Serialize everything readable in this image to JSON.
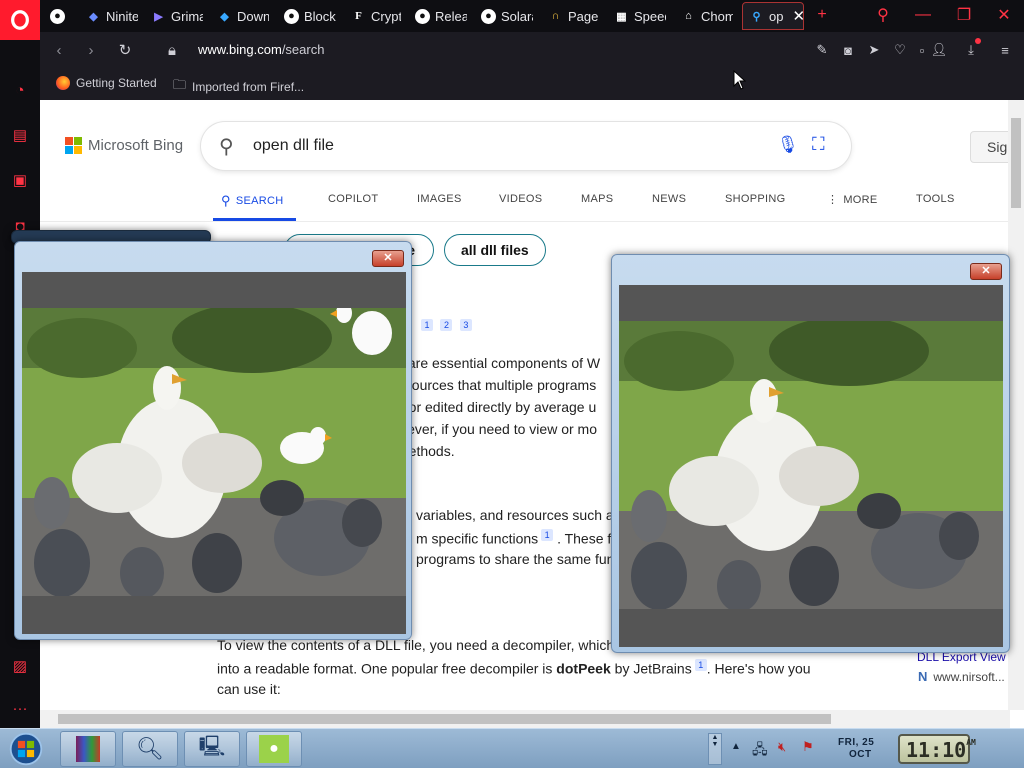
{
  "tabs": [
    {
      "label": "",
      "icon": "opera-logo-icon"
    },
    {
      "label": "",
      "icon": "globe-icon"
    },
    {
      "label": "Ninite",
      "icon": "ninite-icon"
    },
    {
      "label": "Grima",
      "icon": "grimace-icon"
    },
    {
      "label": "Down",
      "icon": "download-icon"
    },
    {
      "label": "Blockr",
      "icon": "blockr-icon"
    },
    {
      "label": "Crypt",
      "icon": "crypto-icon"
    },
    {
      "label": "Releas",
      "icon": "github-icon"
    },
    {
      "label": "Solara",
      "icon": "solara-icon"
    },
    {
      "label": "Page",
      "icon": "headphones-icon"
    },
    {
      "label": "Speed",
      "icon": "grid-icon"
    },
    {
      "label": "Chom",
      "icon": "museum-icon"
    },
    {
      "label": "op",
      "icon": "search-icon",
      "active": true
    }
  ],
  "address": {
    "host": "www.bing.com",
    "path": "/search"
  },
  "bookmarks": [
    {
      "label": "Getting Started",
      "icon": "firefox-icon"
    },
    {
      "label": "Imported from Firef...",
      "icon": "folder-icon"
    }
  ],
  "bing": {
    "logo_text": "Microsoft Bing",
    "query": "open dll file",
    "signin_label": "Sig",
    "nav": [
      {
        "label": "SEARCH",
        "active": true
      },
      {
        "label": "COPILOT"
      },
      {
        "label": "IMAGES"
      },
      {
        "label": "VIDEOS"
      },
      {
        "label": "MAPS"
      },
      {
        "label": "NEWS"
      },
      {
        "label": "SHOPPING"
      },
      {
        "label": "MORE"
      },
      {
        "label": "TOOLS"
      }
    ],
    "chips": [
      "e",
      "all dll files"
    ],
    "citations": [
      "1",
      "2",
      "3"
    ],
    "body_lines": [
      "s are essential components of W",
      "esources that multiple programs",
      "d or edited directly by average u",
      "wever, if you need to view or mo",
      "methods.",
      "variables, and resources such a",
      "m specific functions",
      ". These fi",
      "programs to share the same func",
      "To view the contents of a DLL file, you need a decompiler, which",
      "into a readable format. One popular free decompiler is",
      "dotPeek",
      "by JetBrains",
      ". Here's how you",
      "can use it:"
    ],
    "aside": {
      "title": "DLL Export View",
      "url": "www.nirsoft..."
    }
  },
  "taskbar": {
    "apps": [
      "winrar-icon",
      "magnifier-icon",
      "network-admin-icon",
      "goose-app-icon"
    ],
    "date_line1": "FRI, 25",
    "date_line2": "OCT",
    "clock": "11:10",
    "ampm": "AM"
  },
  "colors": {
    "accent_red": "#ff1b2d",
    "bing_blue": "#174ae4",
    "taskbar": "#8eabcb"
  }
}
